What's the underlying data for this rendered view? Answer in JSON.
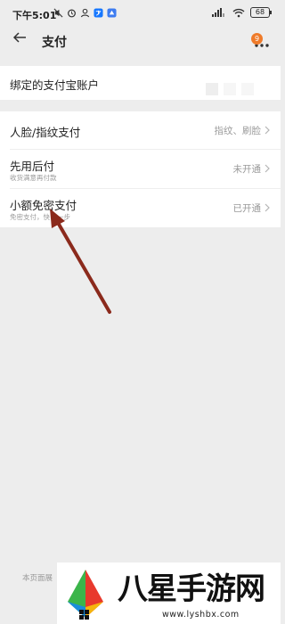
{
  "status_bar": {
    "time": "下午5:01",
    "battery": "68"
  },
  "header": {
    "title": "支付",
    "badge_count": "9"
  },
  "bound_account": {
    "label": "绑定的支付宝账户"
  },
  "payments": {
    "face": {
      "label": "人脸/指纹支付",
      "value": "指纹、刷脸"
    },
    "pay_later": {
      "label": "先用后付",
      "subtitle": "收货满意再付款",
      "value": "未开通"
    },
    "small_pay": {
      "label": "小额免密支付",
      "subtitle": "免密支付，快",
      "subtitle_tail": "一步",
      "value": "已开通"
    }
  },
  "footer": {
    "text": "本页面展"
  },
  "watermark": {
    "title": "八星手游网",
    "url": "www.lyshbx.com"
  },
  "colors": {
    "arrow": "#8b2a1c",
    "badge": "#ef7b2a"
  }
}
